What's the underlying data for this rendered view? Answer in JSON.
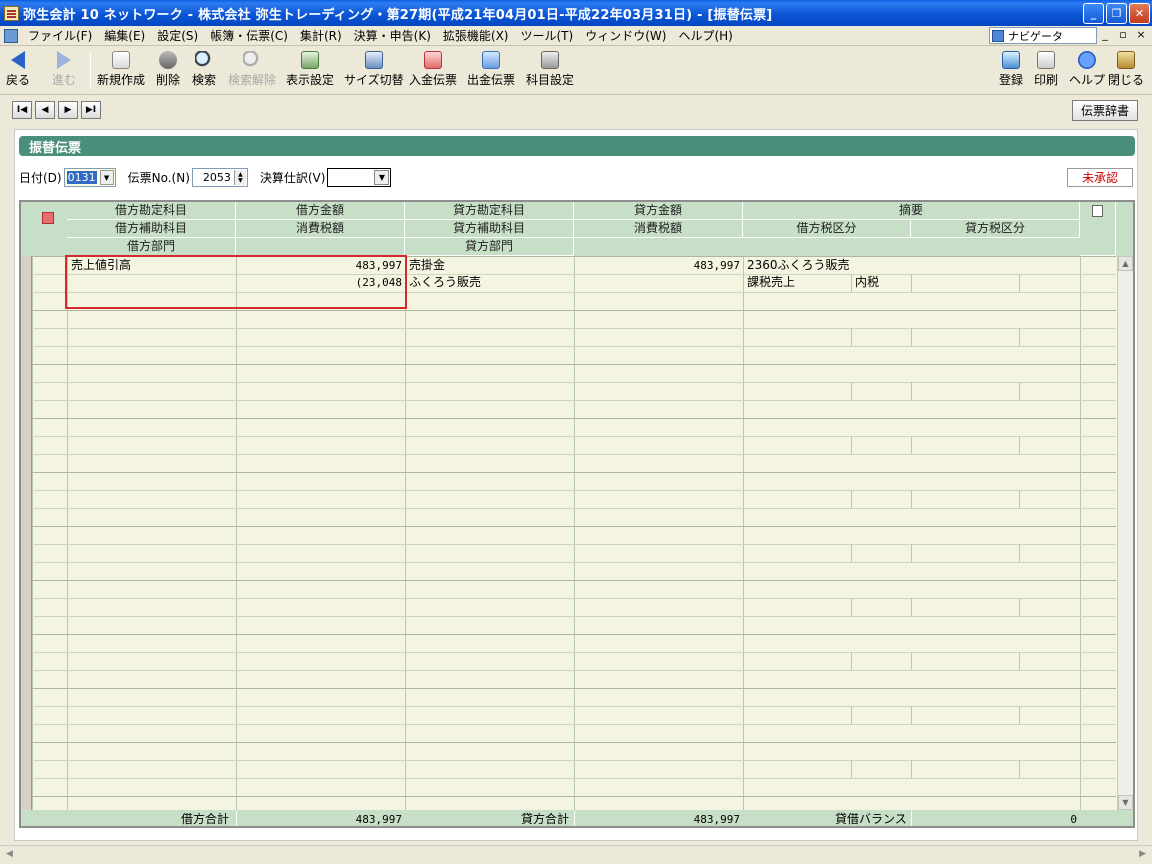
{
  "window": {
    "title": "弥生会計 10 ネットワーク - 株式会社 弥生トレーディング・第27期(平成21年04月01日-平成22年03月31日) - [振替伝票]",
    "minimize": "_",
    "restore": "❐",
    "close": "✕"
  },
  "menu": {
    "items": [
      "ファイル(F)",
      "編集(E)",
      "設定(S)",
      "帳簿・伝票(C)",
      "集計(R)",
      "決算・申告(K)",
      "拡張機能(X)",
      "ツール(T)",
      "ウィンドウ(W)",
      "ヘルプ(H)"
    ],
    "navi": "ナビゲータ",
    "mdi": [
      "_",
      "▫",
      "×"
    ]
  },
  "toolbar": {
    "back": "戻る",
    "forward": "進む",
    "new": "新規作成",
    "delete": "削除",
    "search": "検索",
    "search_clear": "検索解除",
    "display": "表示設定",
    "size": "サイズ切替",
    "in_slip": "入金伝票",
    "out_slip": "出金伝票",
    "subject": "科目設定",
    "register": "登録",
    "print": "印刷",
    "help": "ヘルプ",
    "close": "閉じる"
  },
  "nav": {
    "first": "I◀",
    "prev": "◀",
    "next": "▶",
    "last": "▶I",
    "dictionary": "伝票辞書"
  },
  "panel": {
    "title": "振替伝票"
  },
  "form": {
    "date_label": "日付(D)",
    "date_value": "0131",
    "slip_no_label": "伝票No.(N)",
    "slip_no_value": "2053",
    "settlement_label": "決算仕訳(V)",
    "settlement_value": "",
    "status": "未承認"
  },
  "grid": {
    "headers": {
      "debit_account": "借方勘定科目",
      "debit_amount": "借方金額",
      "credit_account": "貸方勘定科目",
      "credit_amount": "貸方金額",
      "description": "摘要",
      "debit_sub": "借方補助科目",
      "debit_tax": "消費税額",
      "credit_sub": "貸方補助科目",
      "credit_tax": "消費税額",
      "debit_tax_class": "借方税区分",
      "credit_tax_class": "貸方税区分",
      "debit_dept": "借方部門",
      "credit_dept": "貸方部門"
    },
    "row1": {
      "debit_account": "売上値引高",
      "debit_amount": "483,997",
      "credit_account": "売掛金",
      "credit_amount": "483,997",
      "description": "2360ふくろう販売",
      "debit_tax": "(23,048",
      "credit_sub": "ふくろう販売",
      "debit_tax_class": "課税売上",
      "tax_method": "内税"
    },
    "footer": {
      "debit_total_label": "借方合計",
      "debit_total": "483,997",
      "credit_total_label": "貸方合計",
      "credit_total": "483,997",
      "balance_label": "貸借バランス",
      "balance": "0"
    }
  }
}
